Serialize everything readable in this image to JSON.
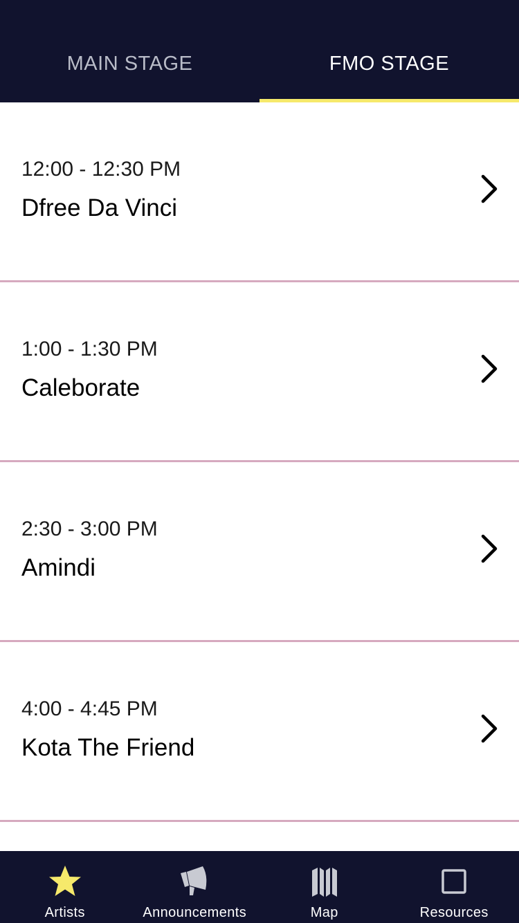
{
  "tabs": [
    {
      "label": "MAIN STAGE",
      "active": false
    },
    {
      "label": "FMO STAGE",
      "active": true
    }
  ],
  "schedule": [
    {
      "time": "12:00 - 12:30 PM",
      "artist": "Dfree Da Vinci"
    },
    {
      "time": "1:00 - 1:30 PM",
      "artist": "Caleborate"
    },
    {
      "time": "2:30 - 3:00 PM",
      "artist": "Amindi"
    },
    {
      "time": "4:00 - 4:45 PM",
      "artist": "Kota The Friend"
    }
  ],
  "bottom_nav": [
    {
      "label": "Artists",
      "icon": "star-icon",
      "active": true
    },
    {
      "label": "Announcements",
      "icon": "megaphone-icon",
      "active": false
    },
    {
      "label": "Map",
      "icon": "map-icon",
      "active": false
    },
    {
      "label": "Resources",
      "icon": "square-icon",
      "active": false
    }
  ],
  "colors": {
    "header_bg": "#11132e",
    "active_indicator": "#f6e96b",
    "divider": "#d6a9bf",
    "active_icon": "#f6e96b",
    "inactive_icon": "#c8cad2"
  }
}
